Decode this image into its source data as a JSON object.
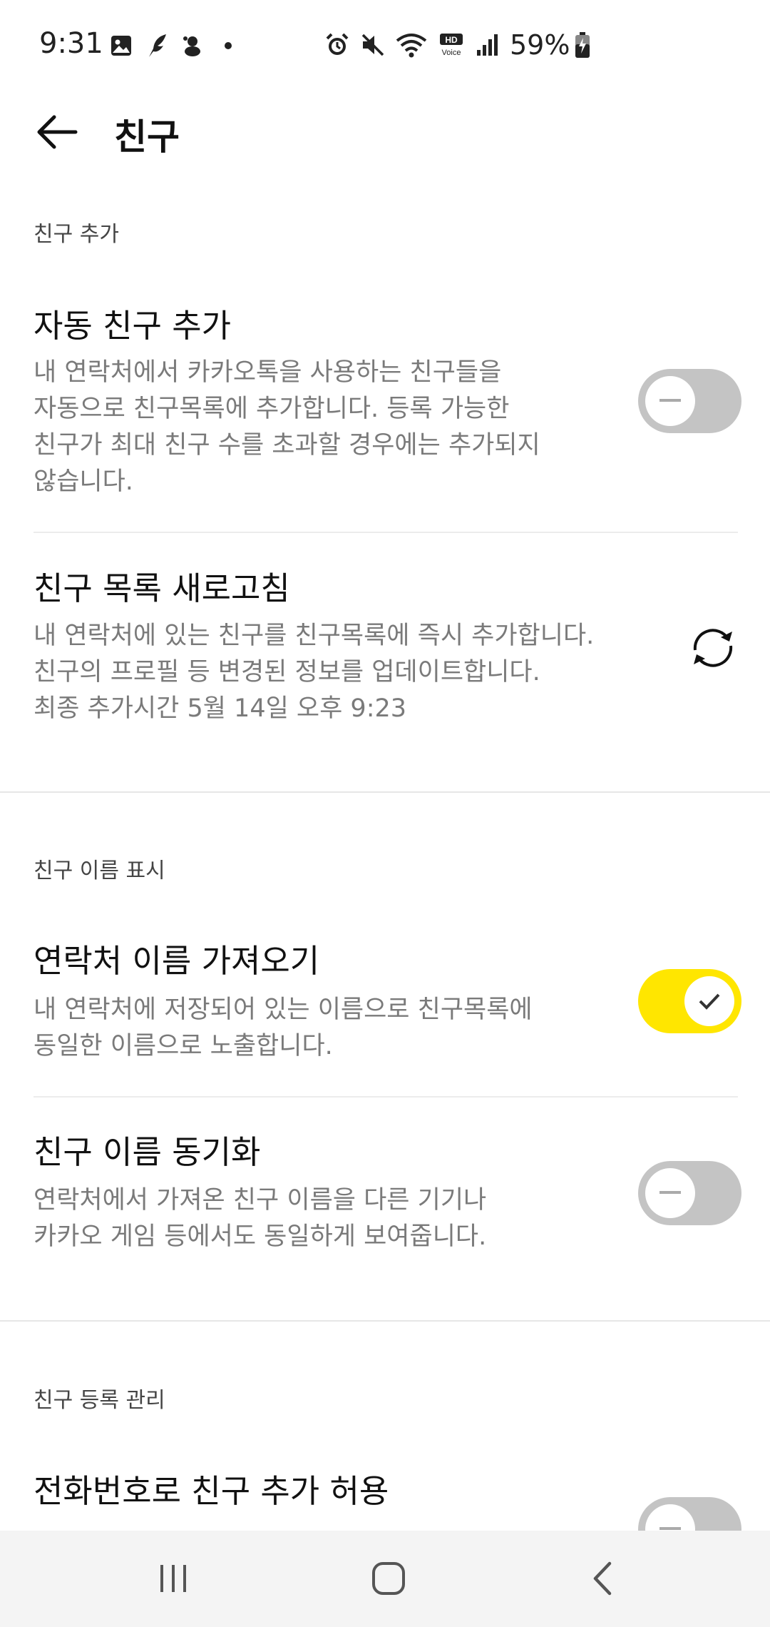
{
  "status_bar": {
    "time": "9:31",
    "left_icons": [
      "gallery-icon",
      "feather-icon",
      "mascot-icon",
      "dot-icon"
    ],
    "right_icons": [
      "alarm-icon",
      "mute-icon",
      "wifi-icon",
      "hd-voice-icon",
      "signal-icon"
    ],
    "battery_percent": "59%"
  },
  "header": {
    "title": "친구",
    "back_icon": "arrow-left-icon"
  },
  "sections": {
    "add_friends": {
      "header": "친구 추가",
      "auto_add": {
        "title": "자동 친구 추가",
        "description": [
          "내 연락처에서 카카오톡을 사용하는 친구들을",
          "자동으로 친구목록에 추가합니다. 등록 가능한",
          "친구가 최대 친구 수를 초과할 경우에는 추가되지",
          "않습니다."
        ],
        "enabled": false
      },
      "refresh": {
        "title": "친구 목록 새로고침",
        "description": [
          "내 연락처에 있는 친구를 친구목록에 즉시 추가합니다.",
          "친구의 프로필 등 변경된 정보를 업데이트합니다.",
          "최종 추가시간 5월 14일 오후 9:23"
        ],
        "icon": "refresh-icon"
      }
    },
    "name_display": {
      "header": "친구 이름 표시",
      "import_contact_name": {
        "title": "연락처 이름 가져오기",
        "description": [
          "내 연락처에 저장되어 있는 이름으로 친구목록에",
          "동일한 이름으로 노출합니다."
        ],
        "enabled": true
      },
      "sync_name": {
        "title": "친구 이름 동기화",
        "description": [
          "연락처에서 가져온 친구 이름을 다른 기기나",
          "카카오 게임 등에서도 동일하게 보여줍니다."
        ],
        "enabled": false
      }
    },
    "registration": {
      "header": "친구 등록 관리",
      "allow_phone_add": {
        "title": "전화번호로 친구 추가 허용",
        "enabled": false
      }
    }
  },
  "colors": {
    "toggle_on": "#ffe600",
    "toggle_off": "#c4c4c4",
    "description_text": "#7a7a7a"
  },
  "nav_bar": {
    "icons": [
      "recents-icon",
      "home-icon",
      "back-icon"
    ]
  }
}
